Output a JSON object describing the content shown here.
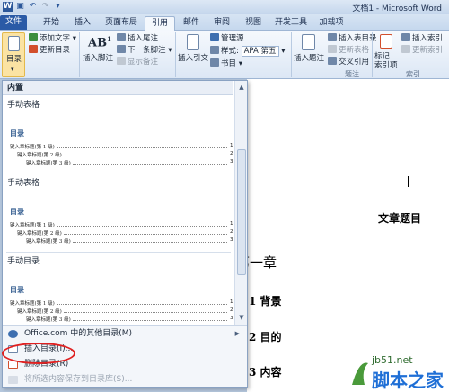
{
  "window": {
    "title": "文档1 - Microsoft Word",
    "qat_icons": [
      "word-icon",
      "save-icon",
      "undo-icon",
      "redo-icon",
      "customize-icon"
    ]
  },
  "tabs": [
    "文件",
    "开始",
    "插入",
    "页面布局",
    "引用",
    "邮件",
    "审阅",
    "视图",
    "开发工具",
    "加载项"
  ],
  "ribbon": {
    "toc_button": "目录",
    "add_text": "添加文字",
    "update_toc": "更新目录",
    "insert_footnote": "插入脚注",
    "insert_endnote": "插入尾注",
    "next_footnote": "下一条脚注",
    "show_notes": "显示备注",
    "insert_citation": "插入引文",
    "manage_sources": "管理源",
    "style_label": "样式:",
    "style_value": "APA 第五",
    "bibliography": "书目",
    "insert_caption": "插入题注",
    "insert_table_of_figures": "插入表目录",
    "update_table": "更新表格",
    "cross_reference": "交叉引用",
    "caption_group": "题注",
    "mark_entry": "标记\n索引项",
    "insert_index": "插入索引",
    "update_index": "更新索引",
    "index_group": "索引"
  },
  "gallery": {
    "section": "内置",
    "items": [
      {
        "title": "手动表格",
        "heading": "目录",
        "lines": [
          "键入章标题(第 1 级)",
          "键入章标题(第 2 级)",
          "键入章标题(第 3 级)"
        ],
        "pages": [
          "1",
          "2",
          "3"
        ]
      },
      {
        "title": "手动表格",
        "heading": "目录",
        "lines": [
          "键入章标题(第 1 级)",
          "键入章标题(第 2 级)",
          "键入章标题(第 3 级)"
        ],
        "pages": [
          "1",
          "2",
          "3"
        ]
      },
      {
        "title": "手动目录",
        "heading": "目录",
        "lines": [
          "键入章标题(第 1 级)",
          "键入章标题(第 2 级)",
          "键入章标题(第 3 级)"
        ],
        "pages": [
          "1",
          "2",
          "3"
        ]
      }
    ],
    "menu": {
      "office_more": "Office.com 中的其他目录(M)",
      "insert_toc": "插入目录(I)...",
      "remove_toc": "删除目录(R)",
      "save_selection": "将所选内容保存到目录库(S)..."
    }
  },
  "document": {
    "title": "文章题目",
    "lines": [
      "第一章",
      "1 背景",
      "2 目的",
      "3 内容"
    ]
  },
  "watermark": {
    "url": "jb51.net",
    "name": "脚本之家"
  },
  "colors": {
    "file_tab": "#2a5aa6",
    "highlight": "#e02020",
    "toc_heading": "#365f91"
  }
}
